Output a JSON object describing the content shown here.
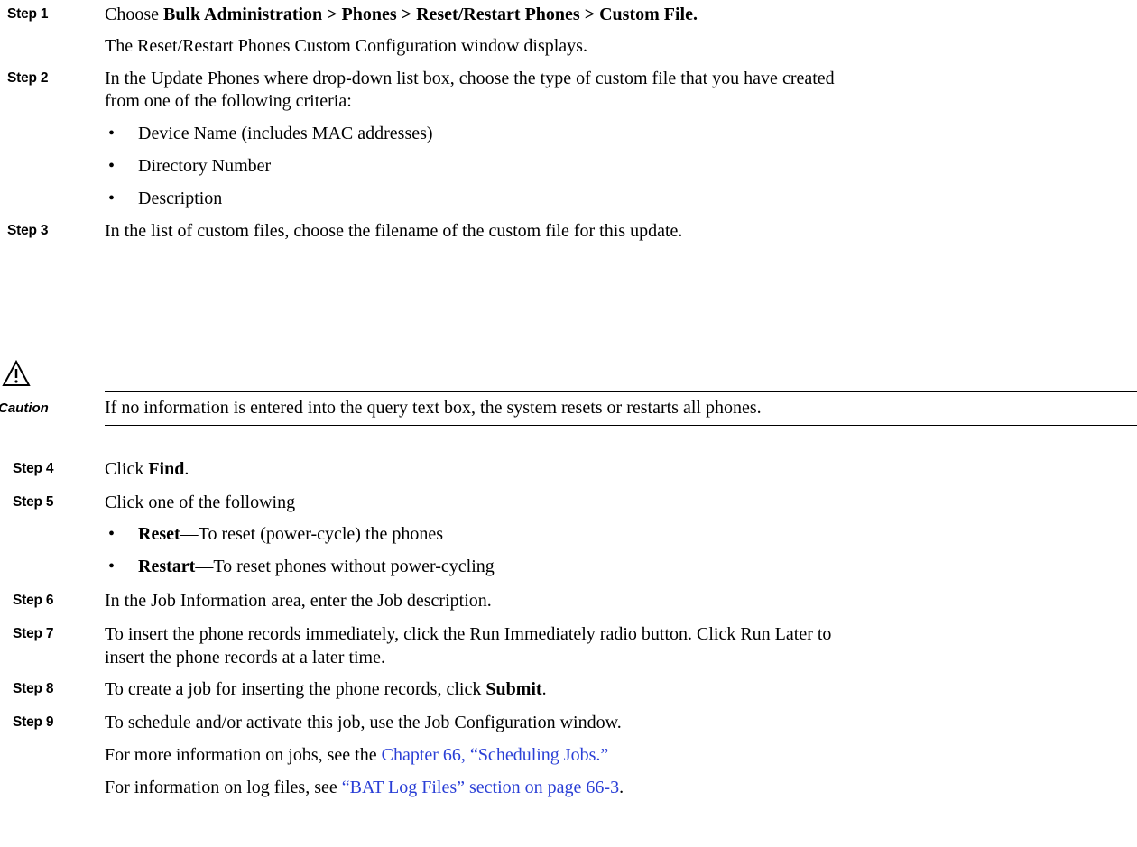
{
  "steps": [
    {
      "label": "Step 1"
    },
    {
      "label": "Step 2"
    },
    {
      "label": "Step 3"
    },
    {
      "label": "Step 4"
    },
    {
      "label": "Step 5"
    },
    {
      "label": "Step 6"
    },
    {
      "label": "Step 7"
    },
    {
      "label": "Step 8"
    },
    {
      "label": "Step 9"
    }
  ],
  "step1": {
    "prefix": "Choose ",
    "path": "Bulk Administration > Phones > Reset/Restart Phones > Custom File.",
    "result": "The Reset/Restart Phones Custom Configuration window displays."
  },
  "step2": {
    "line1": "In the Update Phones where drop-down list box, choose the type of custom file that you have created",
    "line2": "from one of the following criteria:",
    "bullets": [
      "Device Name (includes MAC addresses)",
      "Directory Number",
      "Description"
    ]
  },
  "step3": {
    "text": "In the list of custom files, choose the filename of the custom file for this update."
  },
  "caution": {
    "label": "Caution",
    "text": "If no information is entered into the query text box, the system resets or restarts all phones."
  },
  "step4": {
    "prefix": "Click ",
    "bold": "Find",
    "suffix": "."
  },
  "step5": {
    "text": "Click one of the following",
    "bullets": [
      {
        "bold": "Reset",
        "text": "—To reset (power-cycle) the phones"
      },
      {
        "bold": "Restart",
        "text": "—To reset phones without power-cycling"
      }
    ]
  },
  "step6": {
    "text": "In the Job Information area, enter the Job description."
  },
  "step7": {
    "line1": "To insert the phone records immediately, click the Run Immediately radio button. Click Run Later to",
    "line2": "insert the phone records at a later time."
  },
  "step8": {
    "prefix": "To create a job for inserting the phone records, click ",
    "bold": "Submit",
    "suffix": "."
  },
  "step9": {
    "text": "To schedule and/or activate this job, use the Job Configuration window.",
    "more_prefix": "For more information on jobs, see the ",
    "more_link": "Chapter 66, “Scheduling Jobs.”",
    "log_prefix": "For information on log files, see ",
    "log_link": "“BAT Log Files” section on page 66-3",
    "log_suffix": "."
  },
  "colors": {
    "link": "#2a3fd6"
  }
}
